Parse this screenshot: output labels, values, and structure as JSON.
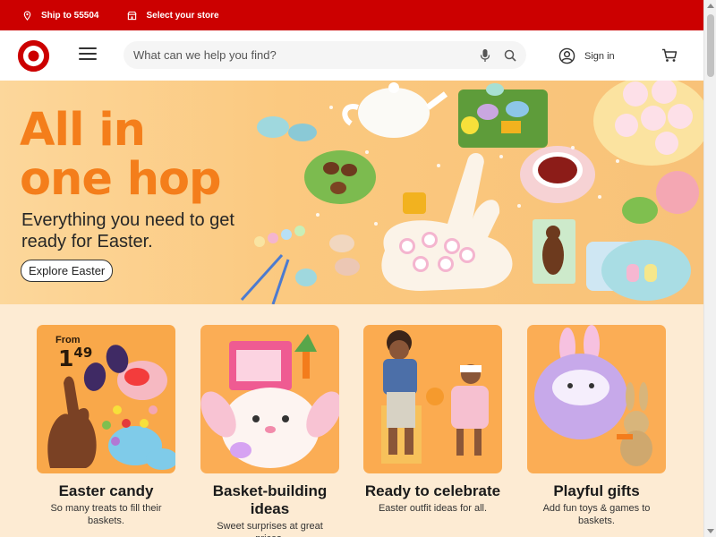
{
  "topbar": {
    "ship_label": "Ship to 55504",
    "store_label": "Select your store",
    "icons": [
      "location-pin-icon",
      "store-icon"
    ]
  },
  "header": {
    "search_placeholder": "What can we help you find?",
    "signin_label": "Sign in",
    "icons": [
      "target-logo",
      "menu-icon",
      "microphone-icon",
      "search-icon",
      "account-icon",
      "cart-icon"
    ]
  },
  "hero": {
    "headline_line1": "All in",
    "headline_line2": "one hop",
    "subtitle": "Everything you need to get ready for Easter.",
    "cta_label": "Explore Easter"
  },
  "cards": [
    {
      "title": "Easter candy",
      "desc": "So many treats to fill their baskets.",
      "badge_from": "From",
      "badge_price_whole": "1",
      "badge_price_cents": "49"
    },
    {
      "title": "Basket-building ideas",
      "desc": "Sweet surprises at great prices."
    },
    {
      "title": "Ready to celebrate",
      "desc": "Easter outfit ideas for all."
    },
    {
      "title": "Playful gifts",
      "desc": "Add fun toys & games to baskets."
    }
  ],
  "colors": {
    "brand_red": "#cc0000",
    "hero_orange": "#f47e1b",
    "page_bg": "#fdebd3"
  }
}
